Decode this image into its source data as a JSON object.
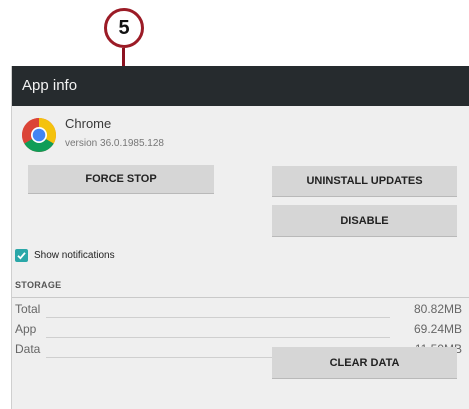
{
  "callout": {
    "number": "5"
  },
  "header": {
    "title": "App info"
  },
  "app": {
    "name": "Chrome",
    "version": "version 36.0.1985.128"
  },
  "buttons": {
    "force_stop": "FORCE STOP",
    "uninstall_updates": "UNINSTALL UPDATES",
    "disable": "DISABLE",
    "clear_data": "CLEAR DATA"
  },
  "notifications": {
    "label": "Show notifications",
    "checked": true
  },
  "storage": {
    "header": "STORAGE",
    "rows": [
      {
        "label": "Total",
        "value": "80.82MB"
      },
      {
        "label": "App",
        "value": "69.24MB"
      },
      {
        "label": "Data",
        "value": "11.59MB"
      }
    ]
  },
  "colors": {
    "titlebar": "#262b2e",
    "callout": "#9b1b26",
    "checkbox": "#2aa7a8",
    "button": "#d6d6d6"
  }
}
